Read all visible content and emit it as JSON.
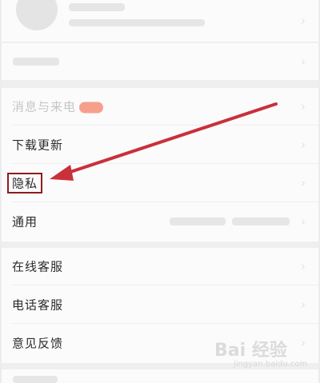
{
  "menu": {
    "message_call": "消息与来电",
    "download_update": "下载更新",
    "privacy": "隐私",
    "general": "通用",
    "online_service": "在线客服",
    "phone_service": "电话客服",
    "feedback": "意见反馈"
  },
  "watermark": {
    "text": "Bai 经验",
    "sub": "jingyan.baidu.com"
  },
  "colors": {
    "highlight_box": "#8b1d1d",
    "arrow": "#c9303b",
    "badge": "#f6a08c"
  }
}
